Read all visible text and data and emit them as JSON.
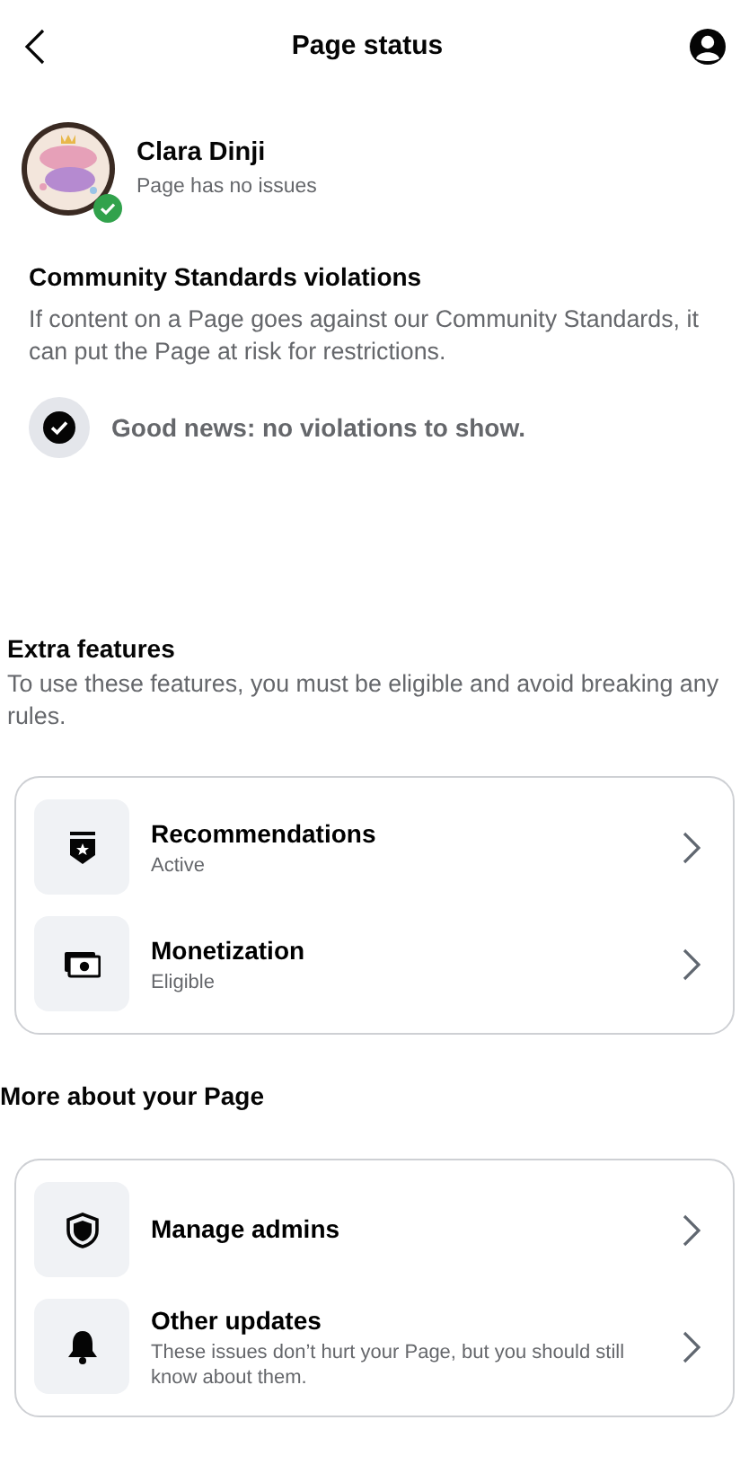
{
  "header": {
    "title": "Page status"
  },
  "profile": {
    "name": "Clara Dinji",
    "status": "Page has no issues",
    "verified": true
  },
  "violations": {
    "title": "Community Standards violations",
    "description": "If content on a Page goes against our Community Standards, it can put the Page at risk for restrictions.",
    "result": "Good news: no violations to show."
  },
  "sections": [
    {
      "title": "Extra features",
      "description": "To use these features, you must be eligible and avoid breaking any rules.",
      "items": [
        {
          "kind": "recommendations",
          "title": "Recommendations",
          "subtitle": "Active"
        },
        {
          "kind": "monetization",
          "title": "Monetization",
          "subtitle": "Eligible"
        }
      ]
    },
    {
      "title": "More about your Page",
      "items": [
        {
          "kind": "admins",
          "title": "Manage admins"
        },
        {
          "kind": "updates",
          "title": "Other updates",
          "subtitle": "These issues don’t hurt your Page, but you should still know about them."
        }
      ]
    }
  ]
}
